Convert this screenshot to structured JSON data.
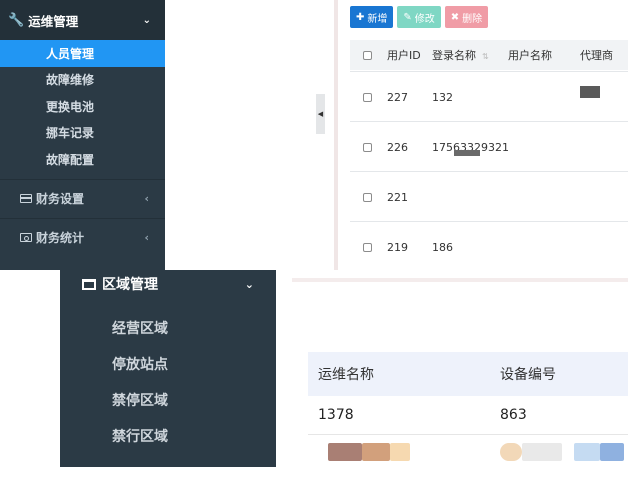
{
  "panelA": {
    "menu_title": "运维管理",
    "items": [
      {
        "label": "人员管理",
        "active": true
      },
      {
        "label": "故障维修",
        "active": false
      },
      {
        "label": "更换电池",
        "active": false
      },
      {
        "label": "挪车记录",
        "active": false
      },
      {
        "label": "故障配置",
        "active": false
      }
    ],
    "groups": [
      {
        "label": "财务设置",
        "icon": "credit-card-icon"
      },
      {
        "label": "财务统计",
        "icon": "money-icon"
      }
    ]
  },
  "panelB": {
    "buttons": {
      "add": "新增",
      "edit": "修改",
      "delete": "删除"
    },
    "columns": {
      "id": "用户ID",
      "login": "登录名称",
      "user": "用户名称",
      "agent": "代理商"
    },
    "rows": [
      {
        "id": "227",
        "login": "132"
      },
      {
        "id": "226",
        "login": "17563329321"
      },
      {
        "id": "221",
        "login": ""
      },
      {
        "id": "219",
        "login": "186"
      }
    ]
  },
  "panelC": {
    "menu_title": "区域管理",
    "items": [
      "经营区域",
      "停放站点",
      "禁停区域",
      "禁行区域"
    ]
  },
  "panelD": {
    "columns": {
      "name": "运维名称",
      "device": "设备编号"
    },
    "rows": [
      {
        "name": "1378",
        "device": "863"
      }
    ]
  },
  "colors": {
    "sidebar_bg": "#2b3a45",
    "active_bg": "#2196f3",
    "btn_add": "#1976d2",
    "btn_edit": "#7fd7c4",
    "btn_delete": "#f09ca6"
  }
}
